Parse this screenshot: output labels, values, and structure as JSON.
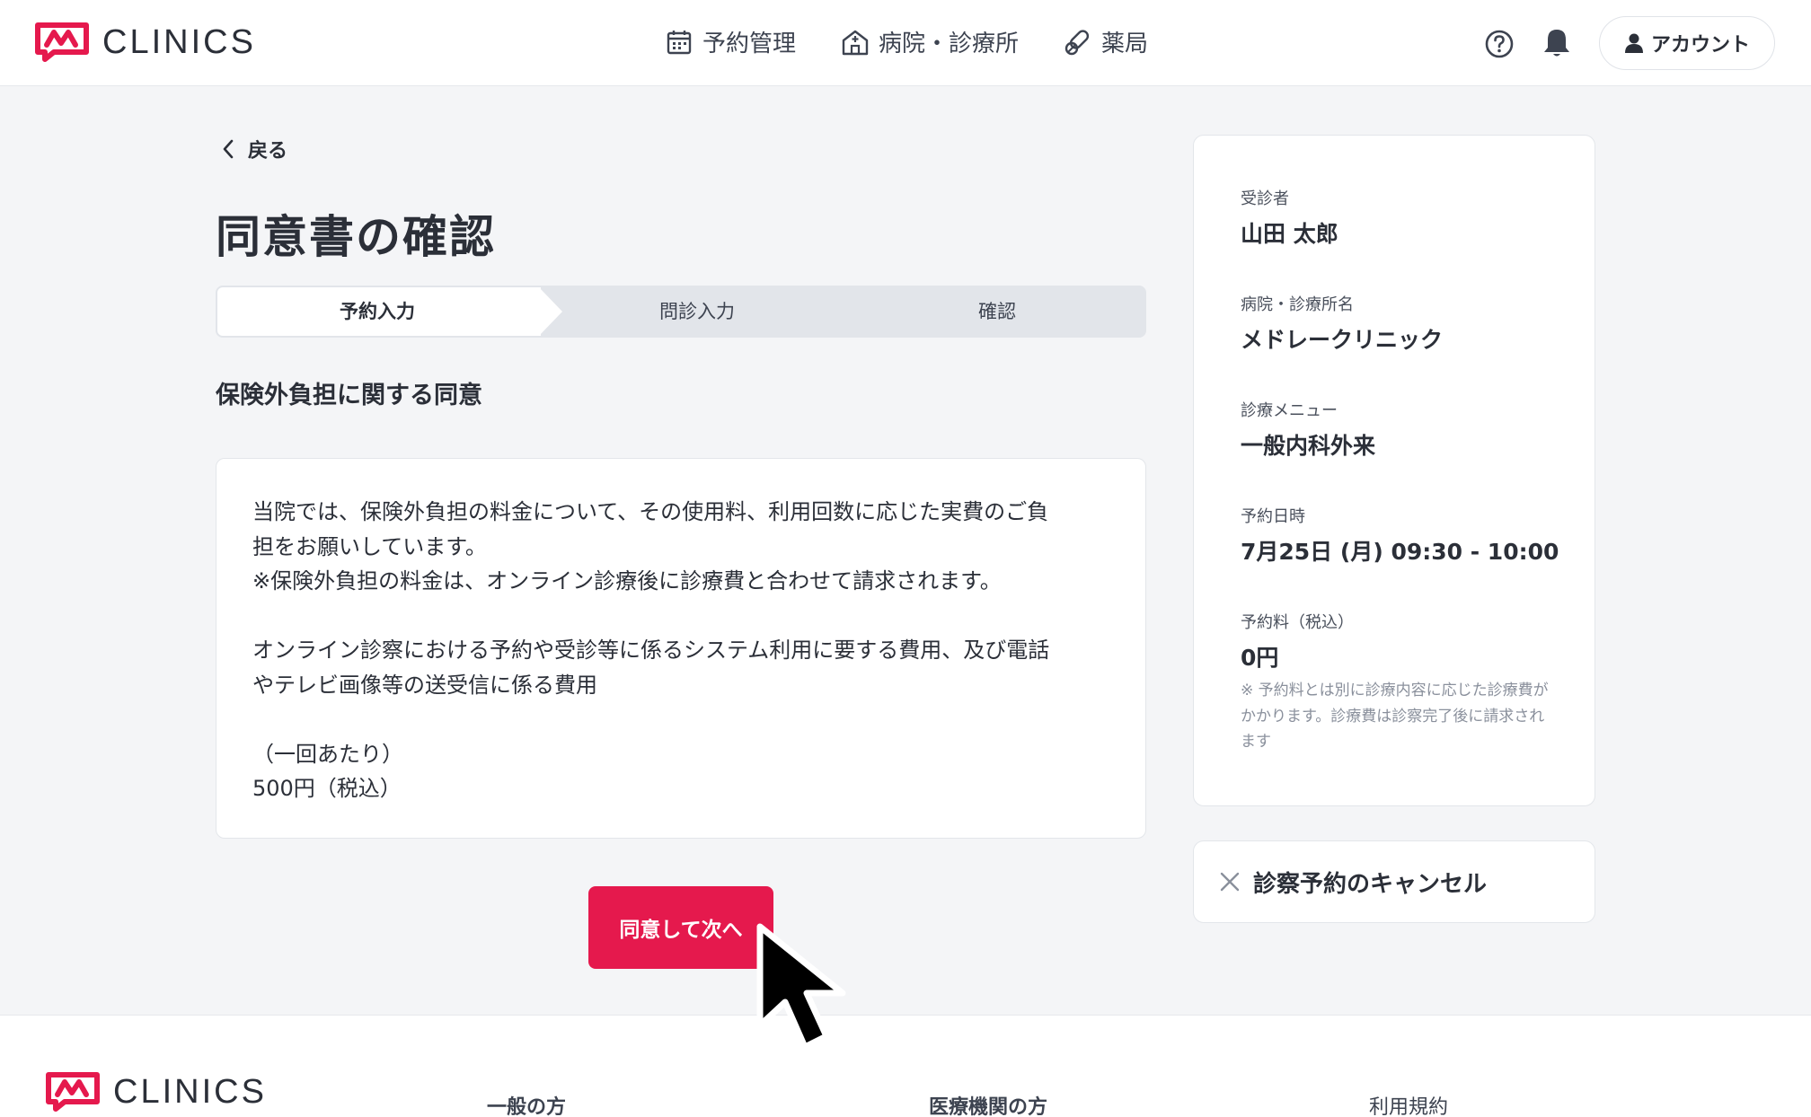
{
  "header": {
    "logo_text": "CLINICS",
    "nav": [
      {
        "label": "予約管理",
        "icon": "calendar-icon"
      },
      {
        "label": "病院・診療所",
        "icon": "hospital-icon"
      },
      {
        "label": "薬局",
        "icon": "pills-icon"
      }
    ],
    "account_label": "アカウント"
  },
  "main": {
    "back_label": "戻る",
    "title": "同意書の確認",
    "steps": [
      "予約入力",
      "問診入力",
      "確認"
    ],
    "section_heading": "保険外負担に関する同意",
    "consent_lines": [
      "当院では、保険外負担の料金について、その使用料、利用回数に応じた実費のご負",
      "担をお願いしています。",
      "※保険外負担の料金は、オンライン診療後に診療費と合わせて請求されます。",
      "",
      "オンライン診察における予約や受診等に係るシステム利用に要する費用、及び電話",
      "やテレビ画像等の送受信に係る費用",
      "",
      "（一回あたり）",
      "500円（税込）"
    ],
    "agree_button": "同意して次へ"
  },
  "summary": {
    "patient_label": "受診者",
    "patient_value": "山田 太郎",
    "clinic_label": "病院・診療所名",
    "clinic_value": "メドレークリニック",
    "menu_label": "診療メニュー",
    "menu_value": "一般内科外来",
    "datetime_label": "予約日時",
    "datetime_value": "7月25日 (月) 09:30 - 10:00",
    "fee_label": "予約料（税込）",
    "fee_value": "0円",
    "fee_note": "※ 予約料とは別に診療内容に応じた診療費がかかります。診療費は診察完了後に請求されます"
  },
  "cancel": {
    "label": "診察予約のキャンセル"
  },
  "footer": {
    "logo_text": "CLINICS",
    "columns": [
      "一般の方",
      "医療機関の方",
      "利用規約"
    ]
  },
  "colors": {
    "brand_red": "#e5194d",
    "text": "#2b2f38",
    "background": "#f4f5f7"
  }
}
